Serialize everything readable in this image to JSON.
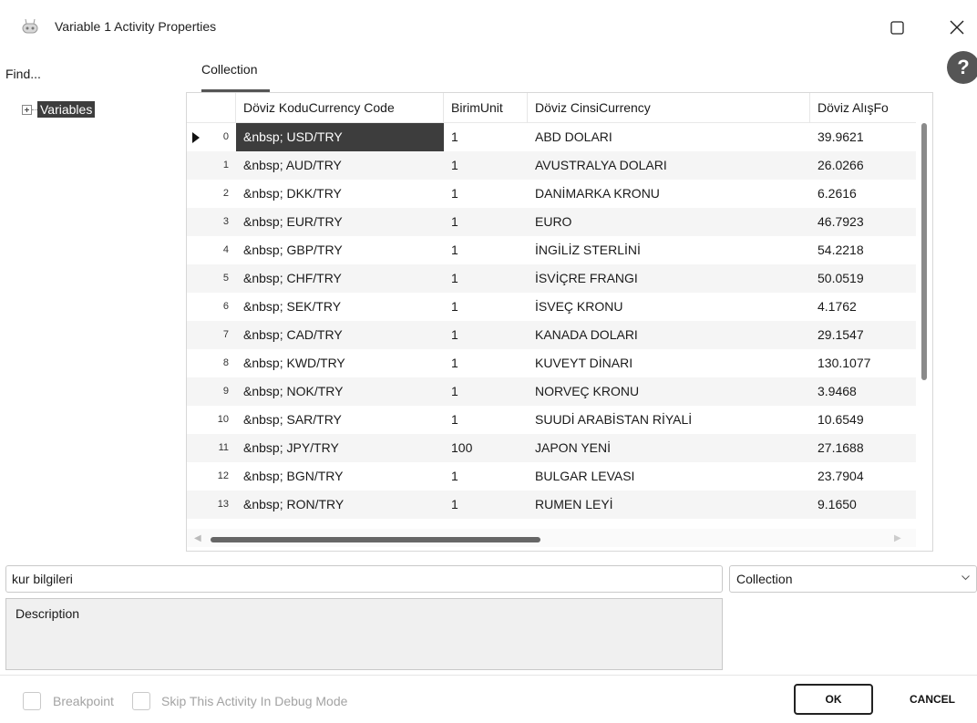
{
  "window": {
    "title": "Variable 1 Activity Properties",
    "icon": "robot-icon",
    "controls": [
      "maximize-icon",
      "close-icon"
    ]
  },
  "left_panel": {
    "find_label": "Find...",
    "tree": [
      {
        "label": "Variables",
        "expander": "plus-box-icon"
      }
    ]
  },
  "tabs": [
    {
      "label": "Collection",
      "selected": true
    }
  ],
  "help_icon": "?",
  "grid": {
    "columns": [
      "Döviz KoduCurrency Code",
      "BirimUnit",
      "Döviz CinsiCurrency",
      "Döviz AlışFo"
    ],
    "rows": [
      {
        "index": "0",
        "code": "&nbsp; USD/TRY",
        "unit": "1",
        "name": "ABD DOLARI",
        "buy": "39.9621",
        "current": true
      },
      {
        "index": "1",
        "code": "&nbsp; AUD/TRY",
        "unit": "1",
        "name": "AVUSTRALYA DOLARI",
        "buy": "26.0266"
      },
      {
        "index": "2",
        "code": "&nbsp; DKK/TRY",
        "unit": "1",
        "name": "DANİMARKA KRONU",
        "buy": "6.2616"
      },
      {
        "index": "3",
        "code": "&nbsp; EUR/TRY",
        "unit": "1",
        "name": "EURO",
        "buy": "46.7923"
      },
      {
        "index": "4",
        "code": "&nbsp; GBP/TRY",
        "unit": "1",
        "name": "İNGİLİZ STERLİNİ",
        "buy": "54.2218"
      },
      {
        "index": "5",
        "code": "&nbsp; CHF/TRY",
        "unit": "1",
        "name": "İSVİÇRE FRANGI",
        "buy": "50.0519"
      },
      {
        "index": "6",
        "code": "&nbsp; SEK/TRY",
        "unit": "1",
        "name": "İSVEÇ KRONU",
        "buy": "4.1762"
      },
      {
        "index": "7",
        "code": "&nbsp; CAD/TRY",
        "unit": "1",
        "name": "KANADA DOLARI",
        "buy": "29.1547"
      },
      {
        "index": "8",
        "code": "&nbsp; KWD/TRY",
        "unit": "1",
        "name": "KUVEYT DİNARI",
        "buy": "130.1077"
      },
      {
        "index": "9",
        "code": "&nbsp; NOK/TRY",
        "unit": "1",
        "name": "NORVEÇ KRONU",
        "buy": "3.9468"
      },
      {
        "index": "10",
        "code": "&nbsp; SAR/TRY",
        "unit": "1",
        "name": "SUUDİ ARABİSTAN RİYALİ",
        "buy": "10.6549"
      },
      {
        "index": "11",
        "code": "&nbsp; JPY/TRY",
        "unit": "100",
        "name": "JAPON YENİ",
        "buy": "27.1688"
      },
      {
        "index": "12",
        "code": "&nbsp; BGN/TRY",
        "unit": "1",
        "name": "BULGAR LEVASI",
        "buy": "23.7904"
      },
      {
        "index": "13",
        "code": "&nbsp; RON/TRY",
        "unit": "1",
        "name": "RUMEN LEYİ",
        "buy": "9.1650"
      }
    ]
  },
  "variable_name": "kur bilgileri",
  "variable_type": {
    "selected": "Collection"
  },
  "description": {
    "placeholder": "Description"
  },
  "options": [
    {
      "label": "Breakpoint",
      "checked": false
    },
    {
      "label": "Skip This Activity In Debug Mode",
      "checked": false
    }
  ],
  "buttons": {
    "ok": "OK",
    "cancel": "CANCEL"
  },
  "colors": {
    "selection": "#3d3d3d",
    "alt_row": "#f5f5f5",
    "text": "#1a1a1a",
    "disabled_text": "#a3a3a3"
  }
}
